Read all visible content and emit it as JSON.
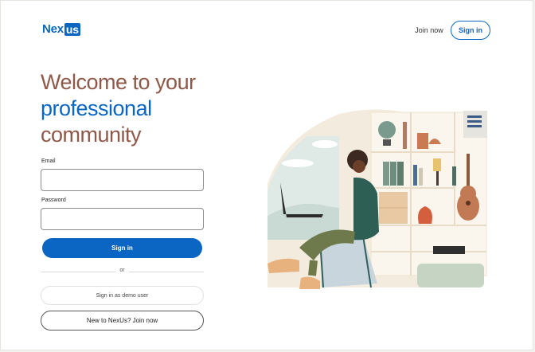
{
  "header": {
    "logo_text": "Nex",
    "logo_box_text": "us",
    "join_now": "Join now",
    "sign_in": "Sign in"
  },
  "hero": {
    "line1": "Welcome to your",
    "line2": "professional",
    "line3": "community"
  },
  "form": {
    "email_label": "Email",
    "email_value": "",
    "password_label": "Password",
    "password_value": "",
    "sign_in": "Sign in",
    "or": "or",
    "demo": "Sign in as demo user",
    "join": "New to NexUs? Join now"
  },
  "colors": {
    "brand": "#0a66c2",
    "heading": "#8f5849"
  }
}
